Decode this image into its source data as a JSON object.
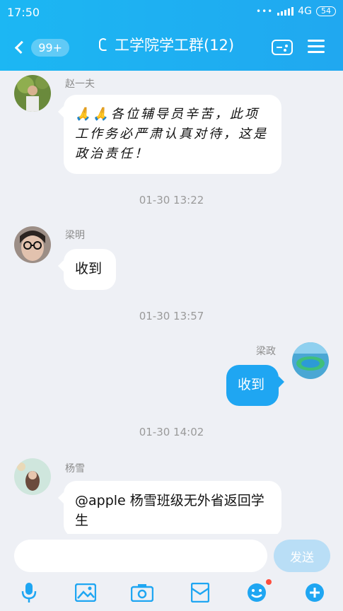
{
  "status_bar": {
    "time": "17:50",
    "dots": "•••",
    "network": "4G",
    "battery": "54"
  },
  "header": {
    "back_badge": "99+",
    "title": "工学院学工群(12)"
  },
  "messages": [
    {
      "sender": "赵一夫",
      "text": "🙏🙏各位辅导员辛苦，此项工作务必严肃认真对待，这是政治责任！",
      "side": "left"
    },
    {
      "timestamp": "01-30 13:22"
    },
    {
      "sender": "梁明",
      "text": "收到",
      "side": "left"
    },
    {
      "timestamp": "01-30 13:57"
    },
    {
      "sender": "梁政",
      "text": "收到",
      "side": "right"
    },
    {
      "timestamp": "01-30 14:02"
    },
    {
      "sender": "杨雪",
      "text": "@apple 杨雪班级无外省返回学生",
      "side": "left"
    }
  ],
  "composer": {
    "input_value": "",
    "send_label": "发送"
  },
  "toolbar": {
    "icons": [
      "microphone-icon",
      "image-icon",
      "camera-icon",
      "red-packet-icon",
      "emoji-icon",
      "plus-icon"
    ],
    "accent": "#1fa6f2",
    "notification_color": "#ff4d3d"
  }
}
